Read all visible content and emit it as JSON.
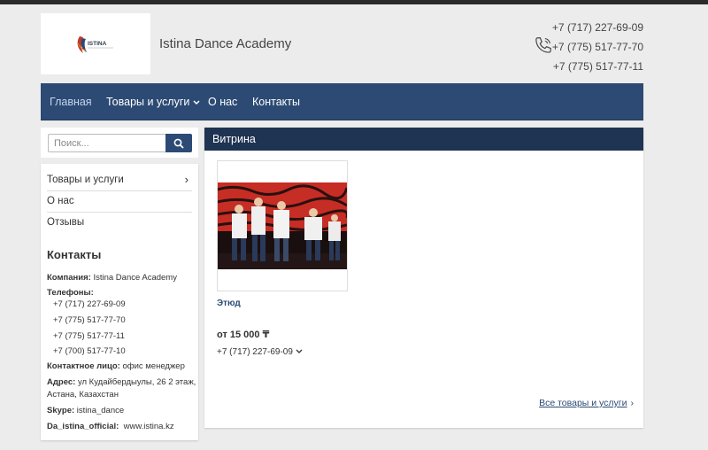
{
  "header": {
    "logo_text": "ISTINA",
    "site_title": "Istina Dance Academy",
    "phones": [
      "+7 (717) 227-69-09",
      "+7 (775) 517-77-70",
      "+7 (775) 517-77-11"
    ]
  },
  "nav": {
    "items": [
      {
        "label": "Главная",
        "active": true
      },
      {
        "label": "Товары и услуги",
        "dropdown": true
      },
      {
        "label": "О нас"
      },
      {
        "label": "Контакты"
      }
    ]
  },
  "search": {
    "placeholder": "Поиск...",
    "icon": "search-icon"
  },
  "sidebar": {
    "menu": [
      "Товары и услуги",
      "О нас",
      "Отзывы"
    ],
    "contacts_title": "Контакты",
    "company_label": "Компания:",
    "company_value": "Istina Dance Academy",
    "phones_label": "Телефоны:",
    "phones": [
      "+7 (717) 227-69-09",
      "+7 (775) 517-77-70",
      "+7 (775) 517-77-11",
      "+7 (700) 517-77-10"
    ],
    "contact_person_label": "Контактное лицо:",
    "contact_person_value": "офис менеджер",
    "address_label": "Адрес:",
    "address_line1": "ул Кудайбердыулы, 26 2 этаж,",
    "address_line2": "Астана, Казахстан",
    "skype_label": "Skype:",
    "skype_value": "istina_dance",
    "social_label": "Da_istina_official:",
    "social_value": "www.istina.kz"
  },
  "main": {
    "section_title": "Витрина",
    "product": {
      "name": "Этюд",
      "price": "от 15 000 ₸",
      "phone": "+7 (717) 227-69-09"
    },
    "all_link": "Все товары и услуги"
  },
  "colors": {
    "nav": "#2c4a74",
    "section_head": "#1f3352",
    "background": "#ececec"
  }
}
